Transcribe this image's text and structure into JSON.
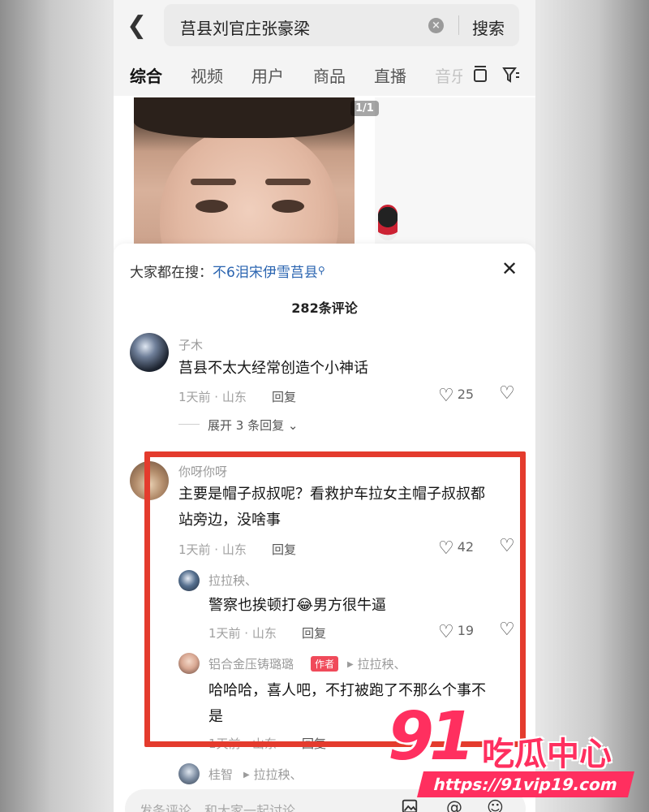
{
  "header": {
    "search_query": "莒县刘官庄张豪梁",
    "search_button": "搜索",
    "tabs": [
      "综合",
      "视频",
      "用户",
      "商品",
      "直播",
      "音乐"
    ]
  },
  "video": {
    "image_count": "1/1"
  },
  "comments_sheet": {
    "trending_prefix": "大家都在搜：",
    "trending_term": "不6泪宋伊雪莒县",
    "count_label": "282条评论",
    "comments": [
      {
        "username": "子木",
        "text": "莒县不太大经常创造个小神话",
        "meta": "1天前 · 山东",
        "reply_label": "回复",
        "likes": "25",
        "expand_label": "展开 3 条回复"
      },
      {
        "username": "你呀你呀",
        "text_line1": "主要是帽子叔叔呢？看救护车拉女主帽子叔叔都",
        "text_line2": "站旁边，没啥事",
        "meta": "1天前 · 山东",
        "reply_label": "回复",
        "likes": "42",
        "replies": [
          {
            "username": "拉拉秧、",
            "text_a": "警察也挨顿打",
            "text_b": "男方很牛逼",
            "meta": "1天前 · 山东",
            "reply_label": "回复",
            "likes": "19"
          },
          {
            "username": "铝合金压铸璐璐",
            "author_tag": "作者",
            "reply_to": "拉拉秧、",
            "text_line1": "哈哈哈，喜人吧，不打被跑了不那么个事不",
            "text_line2": "是",
            "meta": "1天前 · 山东",
            "reply_label": "回复"
          },
          {
            "username": "桂智",
            "reply_to": "拉拉秧、"
          }
        ]
      }
    ],
    "input_placeholder": "发条评论，和大家一起讨论"
  },
  "watermark": {
    "number": "91",
    "brand": "吃瓜中心",
    "url": "https://91vip19.com"
  },
  "colors": {
    "highlight_border": "#e43b2d",
    "link": "#2a64b0",
    "author_tag": "#f04a5a",
    "watermark": "#ff2f5f"
  }
}
